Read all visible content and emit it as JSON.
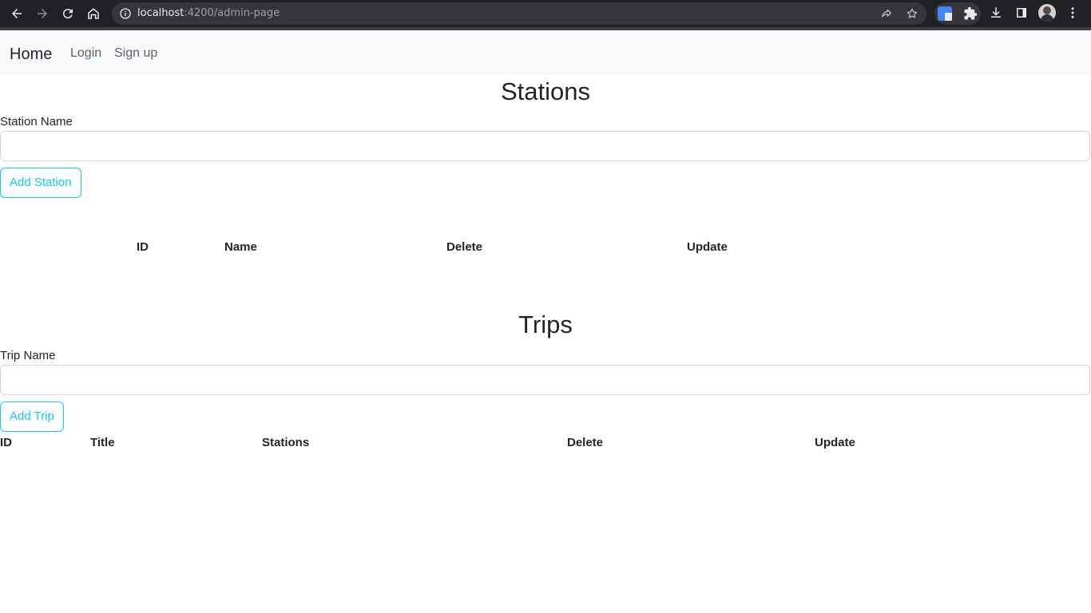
{
  "browser": {
    "url_host": "localhost",
    "url_rest": ":4200/admin-page"
  },
  "navbar": {
    "brand": "Home",
    "links": [
      "Login",
      "Sign up"
    ]
  },
  "stations": {
    "title": "Stations",
    "label": "Station Name",
    "input_value": "",
    "button": "Add Station",
    "columns": [
      "ID",
      "Name",
      "Delete",
      "Update"
    ]
  },
  "trips": {
    "title": "Trips",
    "label": "Trip Name",
    "input_value": "",
    "button": "Add Trip",
    "columns": [
      "ID",
      "Title",
      "Stations",
      "Delete",
      "Update"
    ]
  }
}
